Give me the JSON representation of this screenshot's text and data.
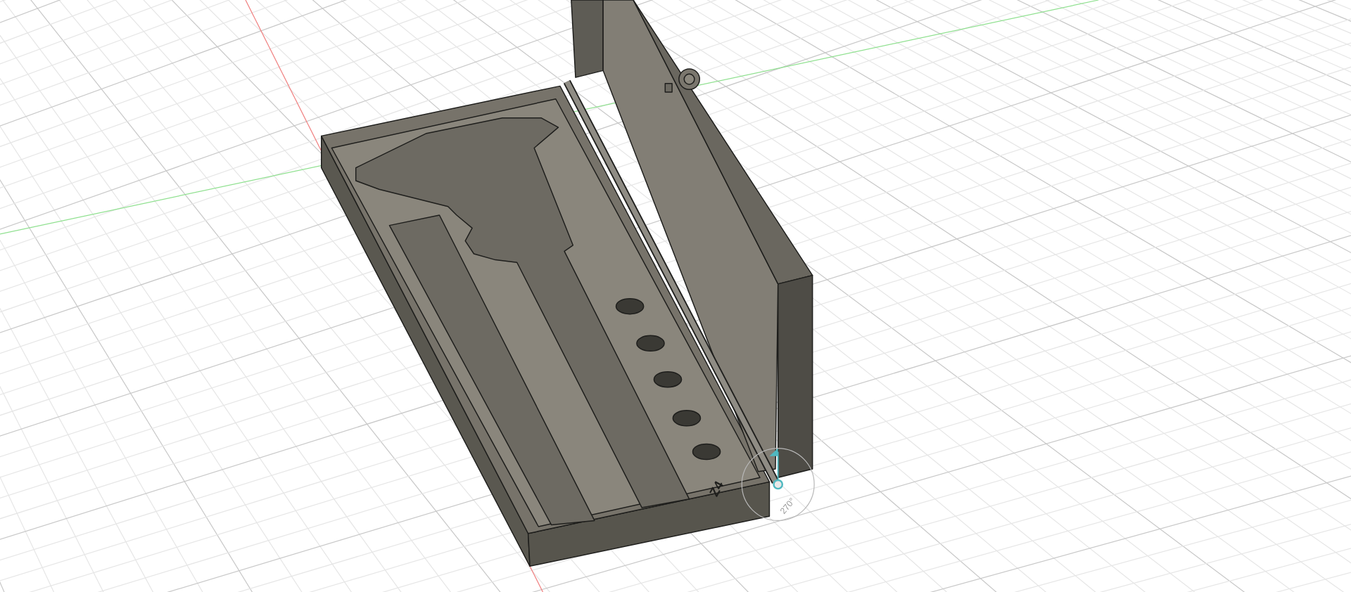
{
  "viewport": {
    "model": {
      "engraving": "Z4"
    },
    "rotation_gizmo": {
      "angle_label": "270°"
    }
  }
}
